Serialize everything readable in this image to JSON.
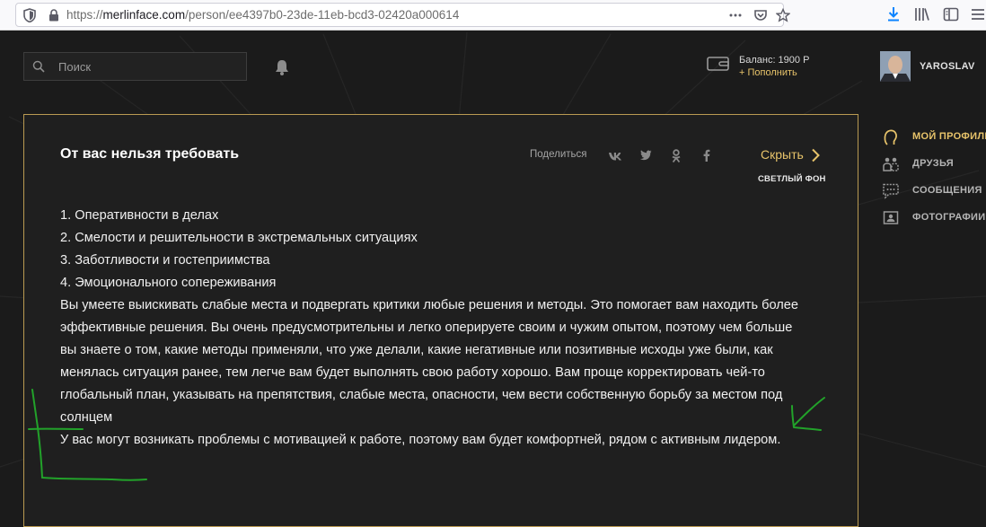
{
  "browser": {
    "url_scheme": "https://",
    "url_host": "merlinface.com",
    "url_path": "/person/ee4397b0-23de-11eb-bcd3-02420a000614"
  },
  "header": {
    "search_placeholder": "Поиск",
    "balance": "Баланс: 1900 Р",
    "topup": "+ Пополнить",
    "username": "YAROSLAV"
  },
  "card": {
    "title": "От вас нельзя требовать",
    "share_label": "Поделиться",
    "hide_label": "Скрыть",
    "light_bg_label": "СВЕТЛЫЙ ФОН",
    "paragraphs": [
      "1. Оперативности в делах",
      "2. Смелости и решительности в экстремальных ситуациях",
      "3. Заботливости и гостеприимства",
      "4. Эмоционального сопереживания",
      "Вы умеете выискивать слабые места и подвергать критики любые решения и методы. Это помогает вам находить более эффективные решения. Вы очень предусмотрительны и легко оперируете своим и чужим опытом, поэтому чем больше вы знаете о том, какие методы применяли, что уже делали, какие негативные или позитивные исходы уже были, как менялась ситуация ранее, тем легче вам будет выполнять свою работу хорошо. Вам проще корректировать чей-то глобальный план, указывать на препятствия, слабые места, опасности, чем вести собственную борьбу за местом под солнцем",
      "У вас могут возникать проблемы с мотивацией к работе, поэтому вам будет комфортней, рядом с активным лидером."
    ]
  },
  "sidebar": {
    "items": [
      {
        "label": "МОЙ ПРОФИЛЬ",
        "icon": "profile-icon",
        "active": true
      },
      {
        "label": "ДРУЗЬЯ",
        "icon": "friends-icon",
        "active": false
      },
      {
        "label": "СООБЩЕНИЯ",
        "icon": "messages-icon",
        "active": false
      },
      {
        "label": "ФОТОГРАФИИ",
        "icon": "photos-icon",
        "active": false
      }
    ]
  },
  "colors": {
    "accent": "#e7c36a",
    "card_border": "#b99a52",
    "background": "#1b1b1b",
    "annotation": "#22a22a"
  }
}
